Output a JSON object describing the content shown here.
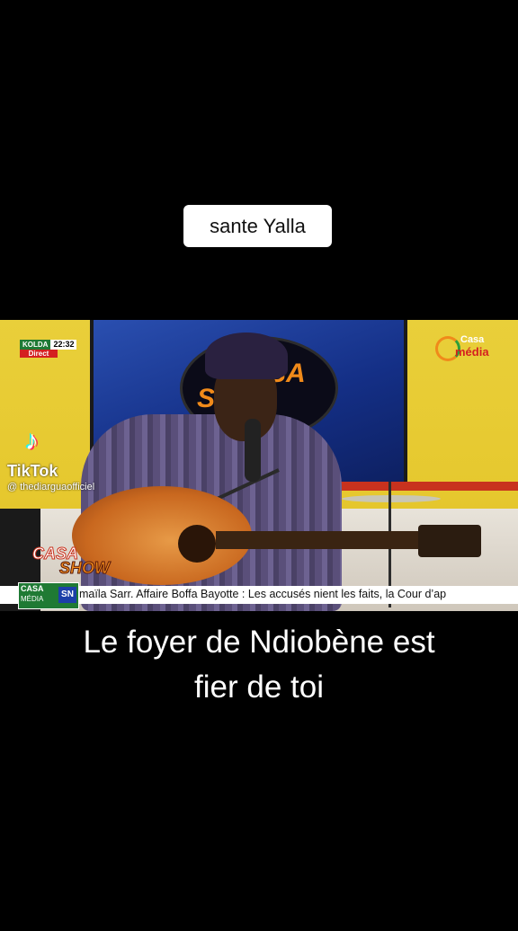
{
  "top_caption": "sante Yalla",
  "video": {
    "kolda": {
      "name": "KOLDA",
      "time": "22:32",
      "status": "Direct"
    },
    "channel_logo": {
      "line1": "Casa",
      "line2": "média"
    },
    "backdrop_logo": {
      "line1": "SA",
      "line2": "S"
    },
    "show_logo": {
      "line1": "CASA",
      "line2": "SHOW"
    },
    "tiktok": {
      "label": "TikTok",
      "handle": "@ thediarguaofficiel"
    },
    "ticker": {
      "badge_line1": "CASA",
      "badge_line2": "MÉDIA",
      "badge_sn": "SN",
      "text": "maïla Sarr.   Affaire Boffa Bayotte : Les accusés nient les faits, la Cour d’ap"
    }
  },
  "bottom_caption": {
    "line1": "Le foyer de Ndiobène est",
    "line2": "fier de toi"
  }
}
